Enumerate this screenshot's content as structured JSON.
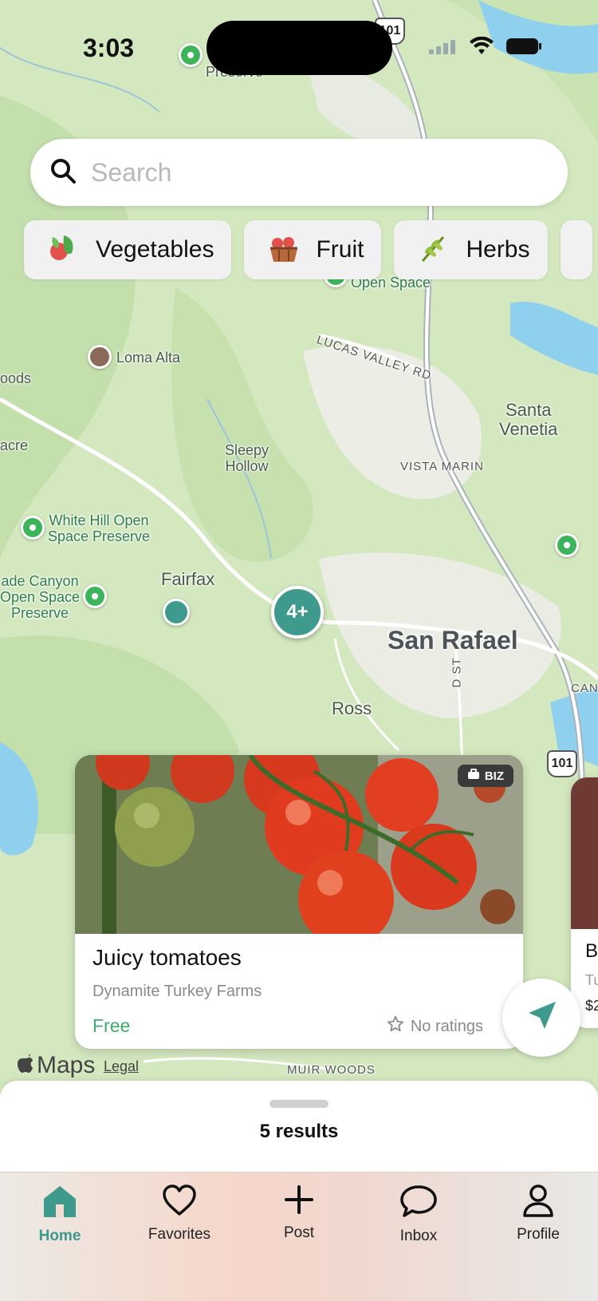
{
  "status_bar": {
    "time": "3:03"
  },
  "search": {
    "placeholder": "Search",
    "value": ""
  },
  "categories": [
    {
      "label": "Vegetables",
      "icon": "vegetables-icon"
    },
    {
      "label": "Fruit",
      "icon": "fruit-basket-icon"
    },
    {
      "label": "Herbs",
      "icon": "herbs-icon"
    }
  ],
  "map": {
    "labels": {
      "loma_alta": "Loma Alta",
      "lucas_valley": "LUCAS VALLEY RD",
      "santa_venetia": "Santa\nVenetia",
      "sleepy_hollow": "Sleepy\nHollow",
      "vista_marin": "VISTA MARIN",
      "white_hill": "White Hill Open\nSpace Preserve",
      "fairfax": "Fairfax",
      "cascade": "ade Canyon\nOpen Space\nPreserve",
      "san_rafael": "San Rafael",
      "ross": "Ross",
      "muir_woods": "MUIR WOODS",
      "open_space": "Open Space",
      "woods": "oods",
      "acre": "acre",
      "preserve_top": "Preserve",
      "d_st": "D ST",
      "can": "CAN",
      "hwy_top": "101",
      "hwy_mid": "101",
      "legal": "Legal",
      "maps_brand": "Maps"
    },
    "cluster_label": "4+",
    "accent": "#3d9a8d"
  },
  "listing_card": {
    "badge": "BIZ",
    "title": "Juicy tomatoes",
    "seller": "Dynamite Turkey Farms",
    "price": "Free",
    "rating": "No ratings"
  },
  "listing_peek": {
    "title": "B",
    "subtitle": "Tu",
    "price": "$2"
  },
  "results_sheet": {
    "count_text": "5 results"
  },
  "tabs": [
    {
      "label": "Home",
      "icon": "home-icon",
      "active": true
    },
    {
      "label": "Favorites",
      "icon": "heart-icon",
      "active": false
    },
    {
      "label": "Post",
      "icon": "plus-icon",
      "active": false
    },
    {
      "label": "Inbox",
      "icon": "chat-bubble-icon",
      "active": false
    },
    {
      "label": "Profile",
      "icon": "person-icon",
      "active": false
    }
  ]
}
